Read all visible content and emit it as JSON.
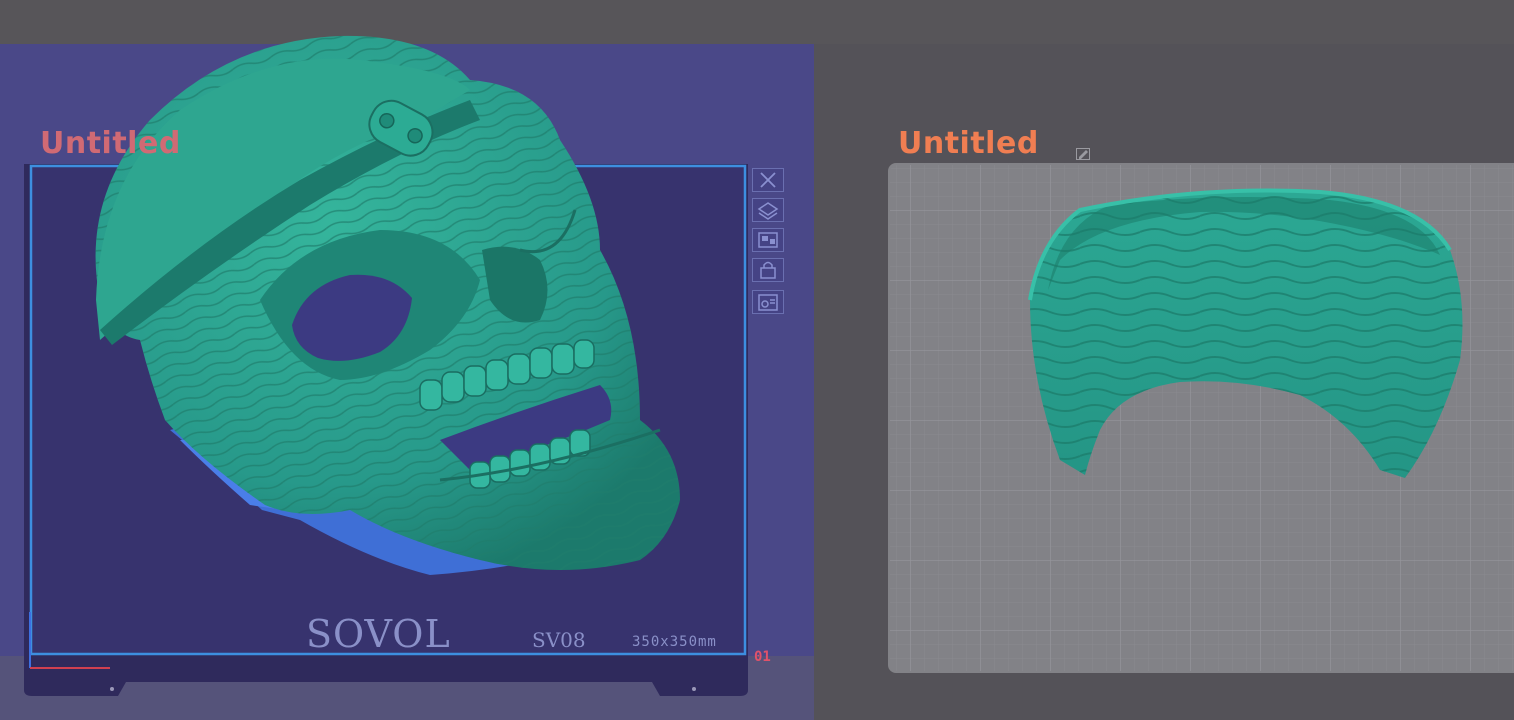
{
  "plates": [
    {
      "title": "Untitled",
      "brand": "SOVOL",
      "model": "SV08",
      "size": "350x350mm",
      "index": "01",
      "toolbar": [
        "close-icon",
        "auto-orient-icon",
        "arrange-icon",
        "lock-icon",
        "settings-icon"
      ]
    },
    {
      "title": "Untitled"
    }
  ],
  "colors": {
    "background": "#545258",
    "active_plate_bg": "#4a4888",
    "plate_surface": "#37336e",
    "selection_outline": "#3d8fe0",
    "model_teal": "#2aa08a",
    "model_overhang_blue": "#3f6fd6",
    "title_left": "#d06a74",
    "title_right": "#f07e52",
    "grid_plate": "#828287"
  }
}
